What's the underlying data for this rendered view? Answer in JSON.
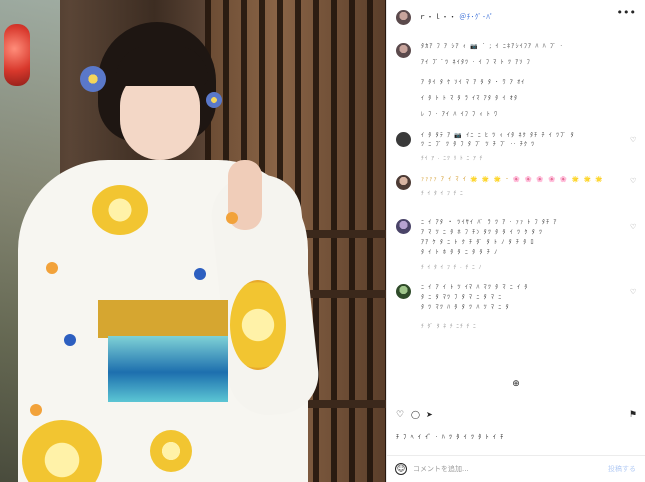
{
  "post": {
    "username": "ｒ・ｌ・・",
    "username_tags": "＠ﾁ･ｸﾞ･ﾊﾟ",
    "menu_icon": "more-dots-icon",
    "menu_glyph": "•••"
  },
  "comments": [
    {
      "lines": [
        "ﾀｶｱ ﾌ ｱ ｼｱ ｨ 📷 ´ ; ｲ ﾆﾈｱｼｲﾌｱ ﾊ ﾊ ﾌﾞ ·",
        "ｱｲ ﾌﾞ ﾟﾂ ﾈｲﾀﾂ · ｲ ﾌ ﾏ ﾄ ﾂ ｱｿ ﾌ",
        "ｱ ﾀｲ ﾀ ｹ ｿｲ ﾏ ｱ ﾀ ﾀ ･ ﾜ ｱ ｵｲ",
        "ｲ ﾀ ﾄ ﾄ ﾏ ﾀ ﾗ ｲﾏ ｱﾀ ﾀ ｲ ｵﾀ",
        "ﾚ ﾌ · ｱｲ ﾊ ｲﾌ ﾌ ｨ ﾄ ﾜ"
      ],
      "meta": ""
    },
    {
      "lines": [
        "ｲ ﾀ ﾀﾃ ｱ 📷 ｲﾆ ﾆ ﾋ ﾂ ｨ ｲﾀ ﾈｸ ﾀﾁ ﾁ ｲ ﾂﾌﾞ ﾀ",
        "ﾂ ﾆ ﾌﾞ ﾂ ﾀ ﾌ ﾀ ﾌﾞ ﾂ ﾁ ﾌﾞ ·· ﾁｸ ﾂ"
      ],
      "meta": "ﾁｲ ｱ · ﾆﾂ ﾘ ﾄ ﾆ ｱ ﾁ"
    },
    {
      "lines": [
        "ｧｧｧｧ ｱ ｲ ﾏ ｲ 🌟 🌟 🌟 ･ 🌸 🌸 🌸 🌸 🌸 🌟 🌟 🌟"
      ],
      "meta": "ﾁ ｲ ﾀ ｲ ﾌ ﾁ ﾆ"
    },
    {
      "lines": [
        "ﾆ ｲ ｱﾀ ・ ﾂｲｻｲ ﾊﾟ ﾗ ﾂ ｱ · ｧｧ ﾄ ﾌ ﾀﾁ ｱ",
        "ｱ ﾏ ﾂ ﾆ ﾀ ﾎ ﾌ ﾁﾝ ﾀﾂ ﾀ ﾀ ｲ ﾂ ｸ ﾀ ﾂ",
        "ｱｱ ｹ ﾀ ﾆ ﾄ ｸ ﾁ ﾀﾞ ﾀ ﾄ ﾉ ﾀ ﾁ ﾀ ﾛ",
        "ﾀ ｲ ﾄ ﾎ ﾀ ﾀ ﾆ ﾀ ﾀ ﾁ ﾉ"
      ],
      "meta": "ﾁ ｲ ﾀ ｲ ﾌ ﾁ · ﾁ ﾆ ﾉ"
    },
    {
      "lines": [
        "ﾆ ｲ ｱ ｲ ﾄ ﾂ ｲﾏ ﾊ ﾏﾂ ﾀ ﾏ ﾆ ｲ ﾀ",
        "ﾀ ﾆ ﾀ ﾏﾂ ﾌ ﾀ ﾏ ﾆ ﾀ ﾏ ﾆ",
        "ﾀ ﾂ ﾏﾂ ﾊ ﾀ ﾀ ﾂ ﾊ ﾂ ﾏ ﾆ ﾀ"
      ],
      "meta": "ﾁ ﾀﾞ ﾀ ﾈ ﾁ ﾆﾁ ﾁ ﾆ"
    }
  ],
  "load_more_glyph": "⊕",
  "actions": {
    "like_icon": "heart-icon",
    "comment_icon": "comment-icon",
    "share_icon": "send-icon",
    "save_icon": "bookmark-icon",
    "like_glyph": "♡",
    "comment_glyph": "◯",
    "share_glyph": "➤",
    "save_glyph": "⚑"
  },
  "likes_text": "ﾁ ﾌ ﾍ ｲ ｲﾟ · ﾊ ﾂ ﾀ ｲ ﾂ ﾀ ﾄ ｲ ﾁ",
  "composer": {
    "placeholder": "コメントを追加...",
    "post_label": "投稿する",
    "emoji_glyph": "☺"
  },
  "colors": {
    "accent": "#3a6fd8",
    "post_disabled": "#b6cdf5"
  }
}
